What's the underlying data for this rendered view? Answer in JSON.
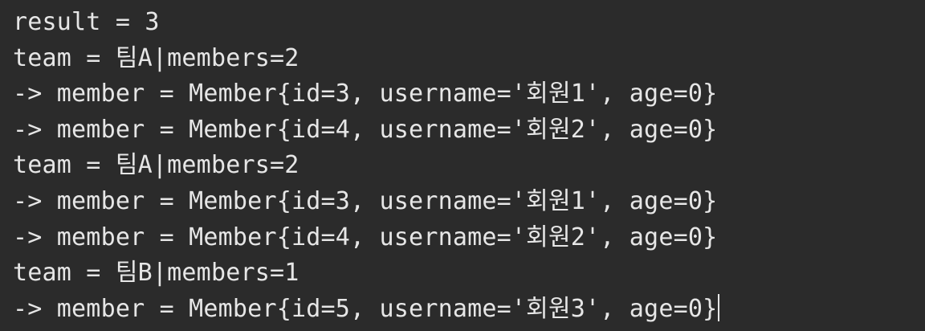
{
  "console": {
    "partial_top_line": "__________ _ ___ _ __",
    "lines": [
      "result = 3",
      "team = 팀A|members=2",
      "-> member = Member{id=3, username='회원1', age=0}",
      "-> member = Member{id=4, username='회원2', age=0}",
      "team = 팀A|members=2",
      "-> member = Member{id=3, username='회원1', age=0}",
      "-> member = Member{id=4, username='회원2', age=0}",
      "team = 팀B|members=1",
      "-> member = Member{id=5, username='회원3', age=0}"
    ]
  },
  "colors": {
    "background": "#2b2b2b",
    "text": "#e6e6e6"
  }
}
